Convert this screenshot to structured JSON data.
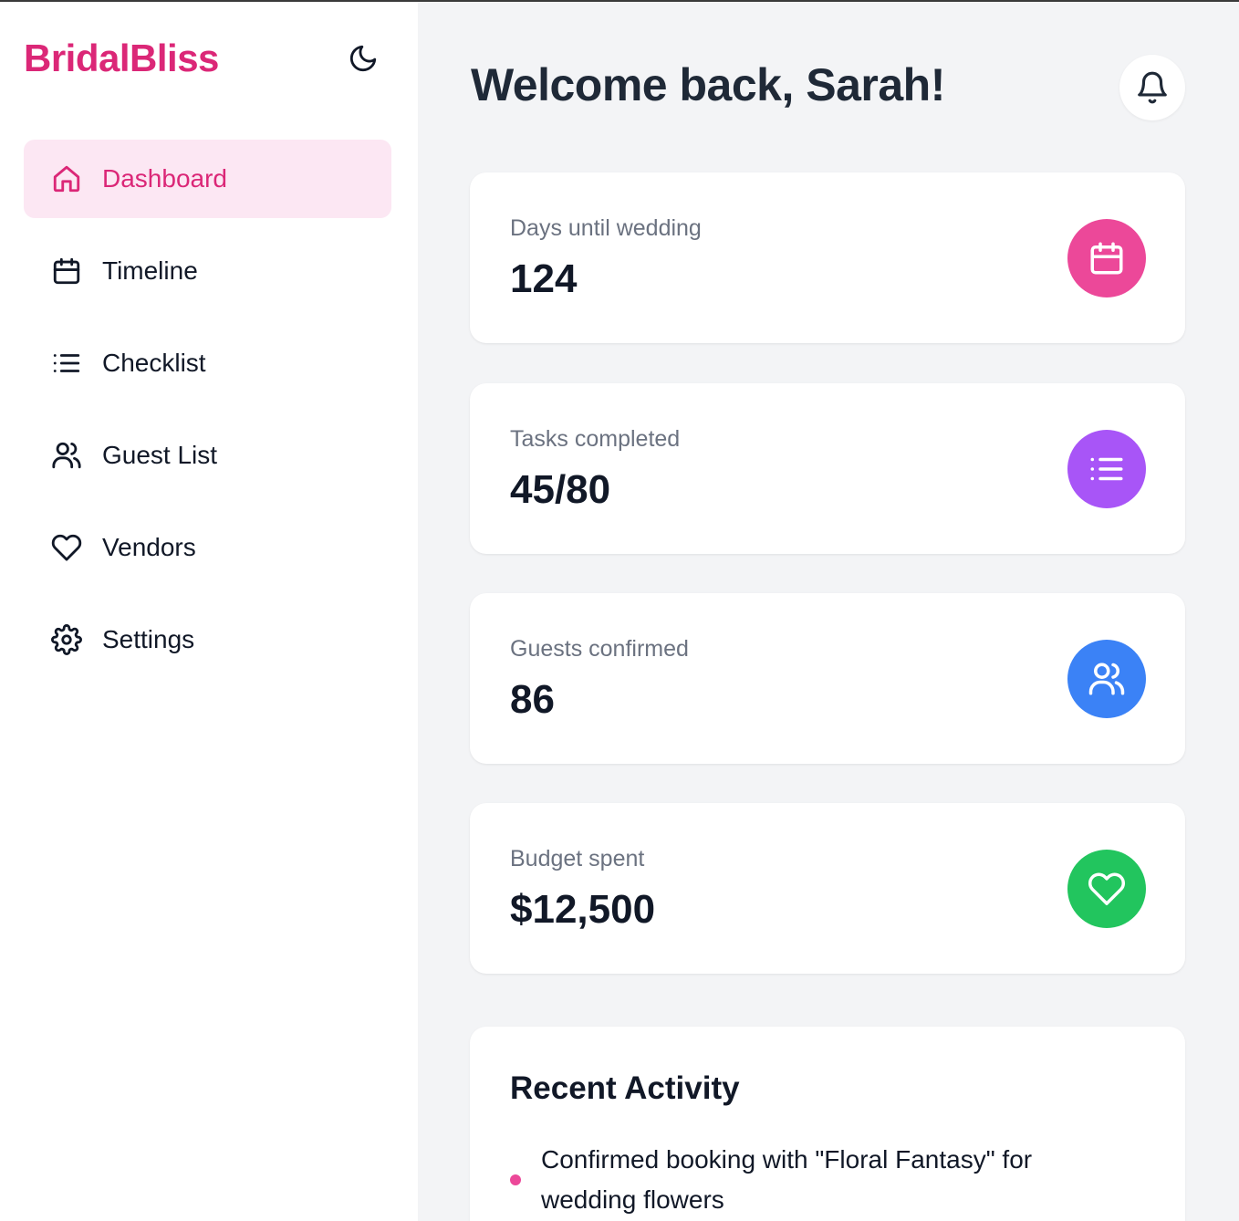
{
  "brand": {
    "name": "BridalBliss",
    "color": "#db2777"
  },
  "sidebar": {
    "theme_toggle_icon": "moon-icon",
    "items": [
      {
        "label": "Dashboard",
        "icon": "home-icon",
        "active": true
      },
      {
        "label": "Timeline",
        "icon": "calendar-icon",
        "active": false
      },
      {
        "label": "Checklist",
        "icon": "list-icon",
        "active": false
      },
      {
        "label": "Guest List",
        "icon": "users-icon",
        "active": false
      },
      {
        "label": "Vendors",
        "icon": "heart-icon",
        "active": false
      },
      {
        "label": "Settings",
        "icon": "gear-icon",
        "active": false
      }
    ]
  },
  "header": {
    "welcome": "Welcome back, Sarah!",
    "notification_icon": "bell-icon"
  },
  "stats": [
    {
      "label": "Days until wedding",
      "value": "124",
      "icon": "calendar-icon",
      "color": "#ec4899"
    },
    {
      "label": "Tasks completed",
      "value": "45/80",
      "icon": "list-icon",
      "color": "#a855f7"
    },
    {
      "label": "Guests confirmed",
      "value": "86",
      "icon": "users-icon",
      "color": "#3b82f6"
    },
    {
      "label": "Budget spent",
      "value": "$12,500",
      "icon": "heart-icon",
      "color": "#22c55e"
    }
  ],
  "activity": {
    "title": "Recent Activity",
    "items": [
      {
        "text": "Confirmed booking with \"Floral Fantasy\" for wedding flowers"
      }
    ]
  }
}
